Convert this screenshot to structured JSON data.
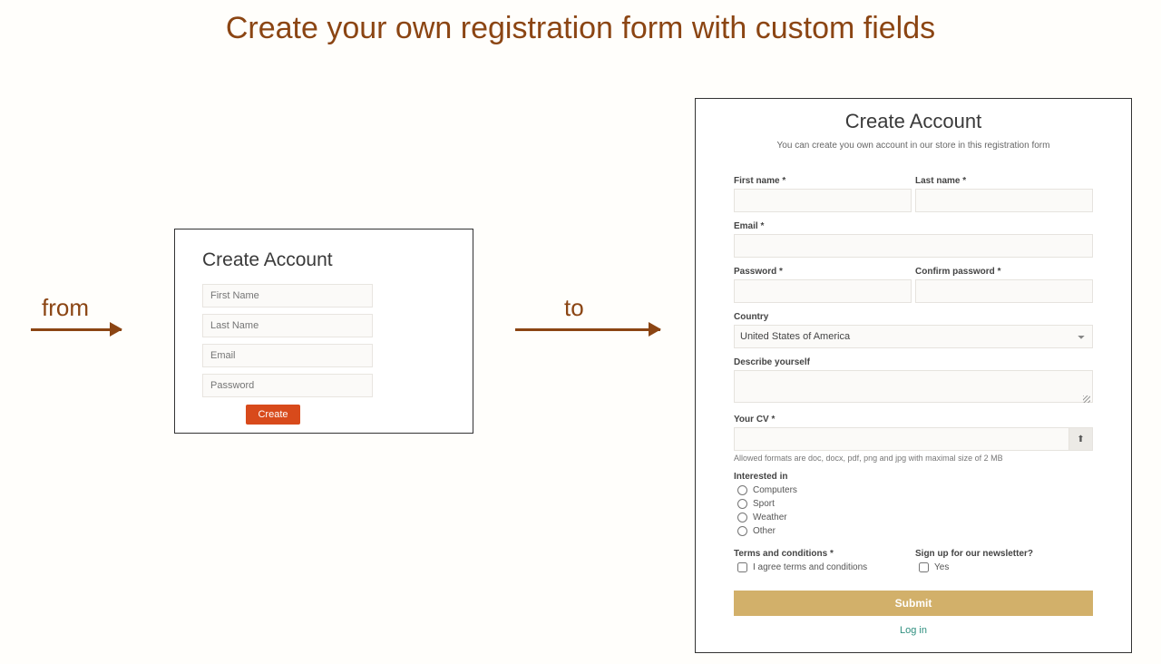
{
  "headline": "Create your own registration form with custom fields",
  "from_label": "from",
  "to_label": "to",
  "simple": {
    "title": "Create Account",
    "first_name_ph": "First Name",
    "last_name_ph": "Last Name",
    "email_ph": "Email",
    "password_ph": "Password",
    "create_btn": "Create"
  },
  "custom": {
    "title": "Create Account",
    "subtitle": "You can create you own account in our store in this registration form",
    "labels": {
      "first_name": "First name *",
      "last_name": "Last name *",
      "email": "Email *",
      "password": "Password *",
      "confirm_password": "Confirm password *",
      "country": "Country",
      "describe": "Describe yourself",
      "cv": "Your CV *",
      "interested": "Interested in",
      "terms": "Terms and conditions *",
      "newsletter": "Sign up for our newsletter?"
    },
    "country_value": "United States of America",
    "cv_hint": "Allowed formats are doc, docx, pdf, png and jpg with maximal size of 2 MB",
    "interested_options": [
      "Computers",
      "Sport",
      "Weather",
      "Other"
    ],
    "agree_text": "I agree terms and conditions",
    "newsletter_yes": "Yes",
    "submit": "Submit",
    "login": "Log in"
  }
}
